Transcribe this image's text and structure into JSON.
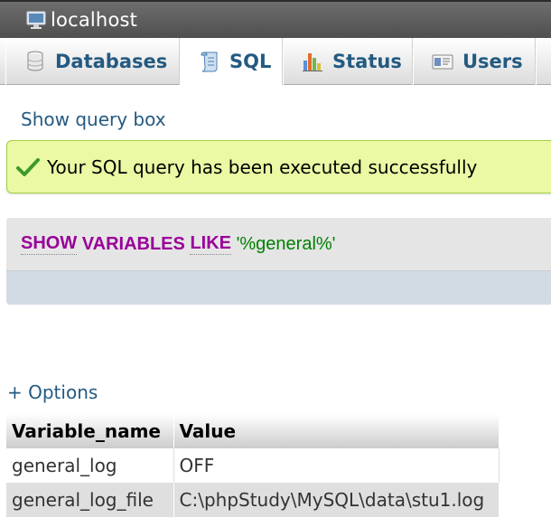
{
  "server": {
    "label": "localhost",
    "icon": "server-monitor-icon"
  },
  "tabs": [
    {
      "label": "Databases",
      "icon": "database-icon",
      "active": false
    },
    {
      "label": "SQL",
      "icon": "sql-scroll-icon",
      "active": true
    },
    {
      "label": "Status",
      "icon": "status-chart-icon",
      "active": false
    },
    {
      "label": "Users",
      "icon": "users-card-icon",
      "active": false
    }
  ],
  "links": {
    "show_query_box": "Show query box",
    "options": "+ Options"
  },
  "success": {
    "message": "Your SQL query has been executed successfully",
    "icon": "checkmark-icon"
  },
  "sql": {
    "kw_show": "SHOW",
    "kw_variables": "VARIABLES",
    "kw_like": "LIKE",
    "pattern": "'%general%'"
  },
  "results": {
    "columns": [
      "Variable_name",
      "Value"
    ],
    "rows": [
      [
        "general_log",
        "OFF"
      ],
      [
        "general_log_file",
        "C:\\phpStudy\\MySQL\\data\\stu1.log"
      ]
    ]
  },
  "colors": {
    "link": "#235a81",
    "success_bg": "#ebf8a4",
    "keyword": "#990099",
    "string": "#008000"
  }
}
